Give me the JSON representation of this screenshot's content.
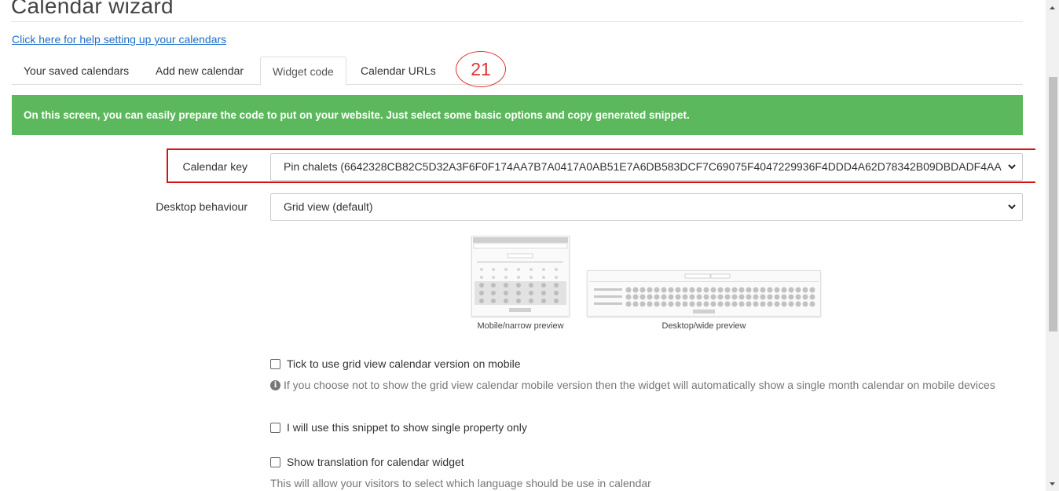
{
  "page": {
    "title": "Calendar wizard",
    "help_link": "Click here for help setting up your calendars"
  },
  "tabs": [
    {
      "label": "Your saved calendars",
      "active": false
    },
    {
      "label": "Add new calendar",
      "active": false
    },
    {
      "label": "Widget code",
      "active": true
    },
    {
      "label": "Calendar URLs",
      "active": false
    }
  ],
  "annotation": {
    "number": "21",
    "color": "#d51313"
  },
  "banner": {
    "text": "On this screen, you can easily prepare the code to put on your website. Just select some basic options and copy generated snippet.",
    "color": "#5cb85c"
  },
  "form": {
    "calendar_key": {
      "label": "Calendar key",
      "value": "Pin chalets (6642328CB82C5D32A3F6F0F174AA7B7A0417A0AB51E7A6DB583DCF7C69075F4047229936F4DDD4A62D78342B09DBDADF4AA"
    },
    "desktop_behaviour": {
      "label": "Desktop behaviour",
      "value": "Grid view (default)"
    }
  },
  "previews": {
    "mobile_caption": "Mobile/narrow preview",
    "desktop_caption": "Desktop/wide preview"
  },
  "options": {
    "grid_mobile": {
      "label": "Tick to use grid view calendar version on mobile",
      "checked": false,
      "hint": "If you choose not to show the grid view calendar mobile version then the widget will automatically show a single month calendar on mobile devices"
    },
    "single_property": {
      "label": "I will use this snippet to show single property only",
      "checked": false
    },
    "translation": {
      "label": "Show translation for calendar widget",
      "checked": false,
      "hint": "This will allow your visitors to select which language should be use in calendar"
    }
  }
}
